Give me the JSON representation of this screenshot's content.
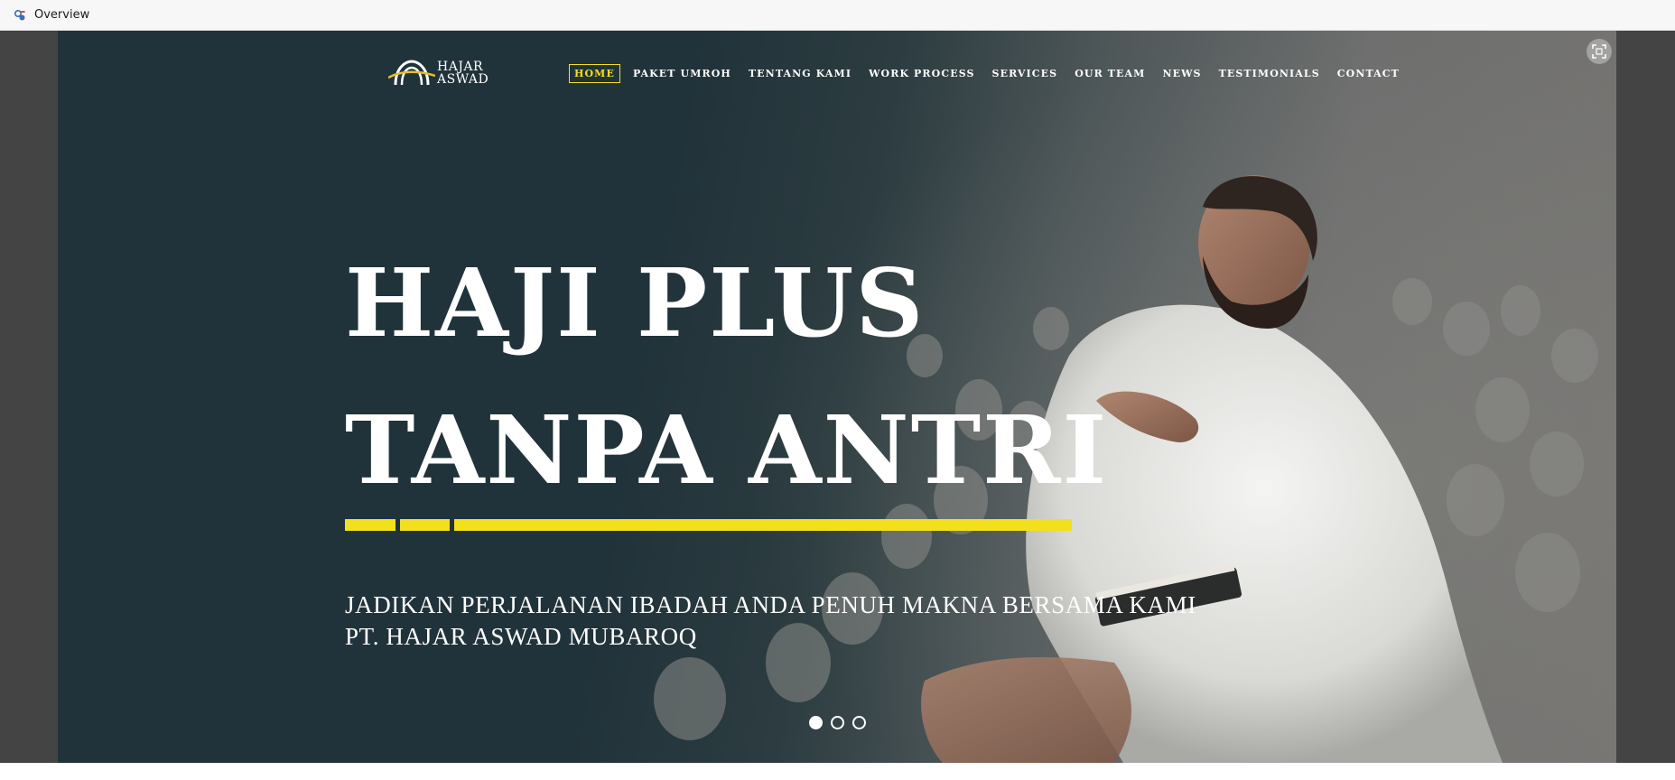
{
  "window": {
    "title": "Overview",
    "icon": "app-icon"
  },
  "site": {
    "logo": {
      "line1": "HAJAR",
      "line2": "ASWAD"
    },
    "nav": [
      {
        "label": "HOME",
        "active": true
      },
      {
        "label": "PAKET UMROH",
        "active": false
      },
      {
        "label": "TENTANG KAMI",
        "active": false
      },
      {
        "label": "WORK PROCESS",
        "active": false
      },
      {
        "label": "SERVICES",
        "active": false
      },
      {
        "label": "OUR TEAM",
        "active": false
      },
      {
        "label": "NEWS",
        "active": false
      },
      {
        "label": "TESTIMONIALS",
        "active": false
      },
      {
        "label": "CONTACT",
        "active": false
      }
    ],
    "hero": {
      "title_line1": "HAJI PLUS",
      "title_line2": "TANPA ANTRI",
      "subtitle_line1": "JADIKAN PERJALANAN IBADAH ANDA PENUH MAKNA BERSAMA KAMI",
      "subtitle_line2": "PT. HAJAR ASWAD MUBAROQ"
    },
    "slider": {
      "slide_count": 3,
      "active_slide": 1
    },
    "colors": {
      "accent": "#f2e01c",
      "background_dark": "#21333a",
      "text": "#ffffff"
    },
    "icons": {
      "fullscreen": "fullscreen-icon"
    }
  }
}
